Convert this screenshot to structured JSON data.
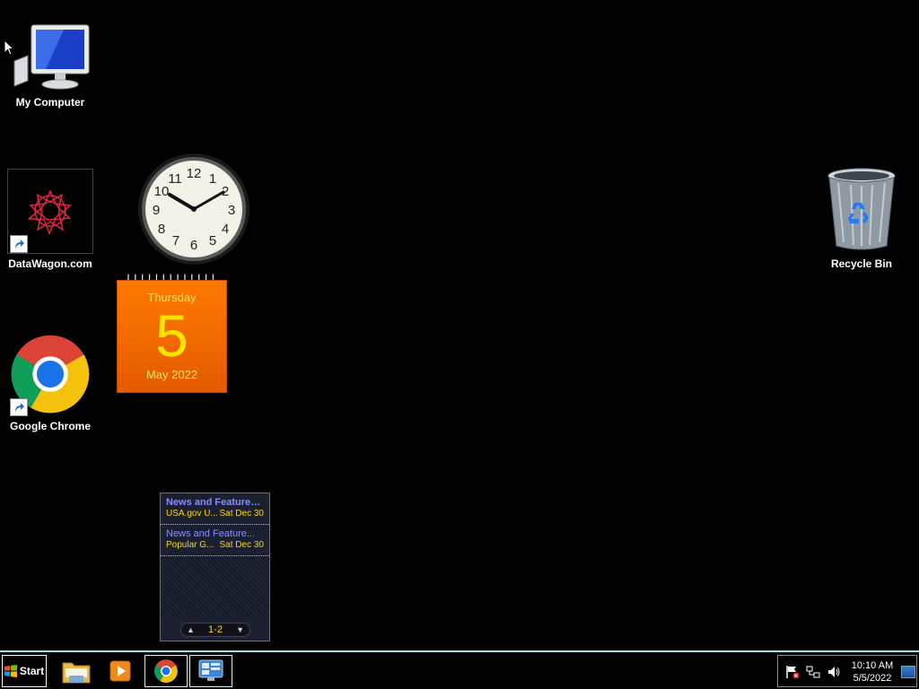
{
  "desktop": {
    "icons": [
      {
        "label": "My Computer",
        "icon": "computer-icon"
      },
      {
        "label": "DataWagon.com",
        "icon": "datawagon-shortcut-icon"
      },
      {
        "label": "Google Chrome",
        "icon": "chrome-icon"
      },
      {
        "label": "Recycle Bin",
        "icon": "recycle-bin-icon"
      }
    ]
  },
  "clock_gadget": {
    "time": "10:10"
  },
  "calendar_gadget": {
    "day_name": "Thursday",
    "day_number": "5",
    "month_year": "May 2022",
    "colors": {
      "background": "#ff7a00",
      "text": "#ffe400"
    }
  },
  "feed_gadget": {
    "items": [
      {
        "title": "News and Features f...",
        "source": "USA.gov U...",
        "date": "Sat Dec 30"
      },
      {
        "title": "News and Feature...",
        "source": "Popular G...",
        "date": "Sat Dec 30"
      }
    ],
    "pager": "1-2"
  },
  "taskbar": {
    "start_label": "Start",
    "buttons": [
      {
        "name": "windows-explorer",
        "icon": "folder-icon",
        "active": false
      },
      {
        "name": "media-player",
        "icon": "media-player-icon",
        "active": false
      },
      {
        "name": "google-chrome",
        "icon": "chrome-icon",
        "active": true
      },
      {
        "name": "gadgets",
        "icon": "gadgets-icon",
        "active": true
      }
    ],
    "tray": {
      "time": "10:10 AM",
      "date": "5/5/2022",
      "icons": [
        "action-center-flag-icon",
        "network-icon",
        "volume-icon"
      ]
    }
  }
}
